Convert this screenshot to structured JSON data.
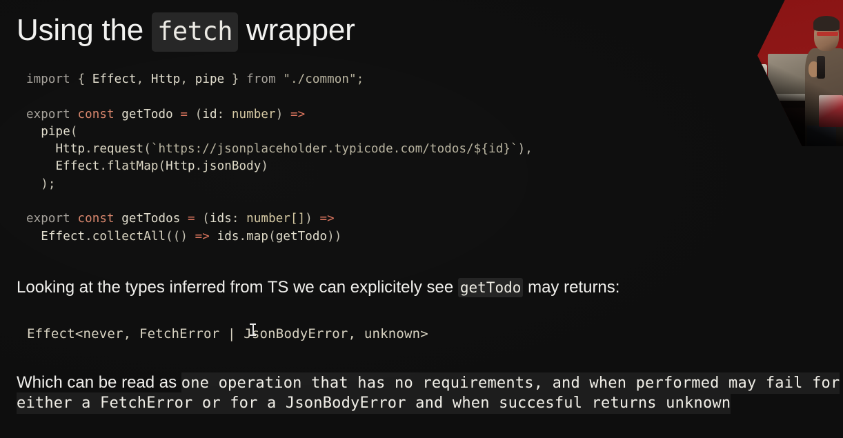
{
  "slide": {
    "background_color": "#0e0e0e",
    "title": {
      "prefix": "Using the ",
      "code": "fetch",
      "suffix": " wrapper"
    },
    "code_block": {
      "language": "typescript",
      "lines": [
        {
          "tokens": [
            {
              "text": "import",
              "kind": "keyword"
            },
            {
              "text": " { ",
              "kind": "punct"
            },
            {
              "text": "Effect",
              "kind": "identifier"
            },
            {
              "text": ", ",
              "kind": "punct"
            },
            {
              "text": "Http",
              "kind": "identifier"
            },
            {
              "text": ", ",
              "kind": "punct"
            },
            {
              "text": "pipe",
              "kind": "identifier"
            },
            {
              "text": " } ",
              "kind": "punct"
            },
            {
              "text": "from",
              "kind": "keyword"
            },
            {
              "text": " \"./common\";",
              "kind": "string"
            }
          ]
        },
        {
          "tokens": []
        },
        {
          "tokens": [
            {
              "text": "export",
              "kind": "keyword"
            },
            {
              "text": " ",
              "kind": "punct"
            },
            {
              "text": "const",
              "kind": "declaration"
            },
            {
              "text": " ",
              "kind": "punct"
            },
            {
              "text": "getTodo",
              "kind": "identifier"
            },
            {
              "text": " ",
              "kind": "punct"
            },
            {
              "text": "=",
              "kind": "operator"
            },
            {
              "text": " (",
              "kind": "punct"
            },
            {
              "text": "id",
              "kind": "identifier"
            },
            {
              "text": ": ",
              "kind": "punct"
            },
            {
              "text": "number",
              "kind": "type"
            },
            {
              "text": ") ",
              "kind": "punct"
            },
            {
              "text": "=>",
              "kind": "operator"
            }
          ]
        },
        {
          "tokens": [
            {
              "text": "  ",
              "kind": "punct"
            },
            {
              "text": "pipe",
              "kind": "identifier"
            },
            {
              "text": "(",
              "kind": "punct"
            }
          ]
        },
        {
          "tokens": [
            {
              "text": "    ",
              "kind": "punct"
            },
            {
              "text": "Http",
              "kind": "identifier"
            },
            {
              "text": ".",
              "kind": "punct"
            },
            {
              "text": "request",
              "kind": "property"
            },
            {
              "text": "(",
              "kind": "punct"
            },
            {
              "text": "`https://jsonplaceholder.typicode.com/todos/${id}`",
              "kind": "string"
            },
            {
              "text": "),",
              "kind": "punct"
            }
          ]
        },
        {
          "tokens": [
            {
              "text": "    ",
              "kind": "punct"
            },
            {
              "text": "Effect",
              "kind": "identifier"
            },
            {
              "text": ".",
              "kind": "punct"
            },
            {
              "text": "flatMap",
              "kind": "property"
            },
            {
              "text": "(",
              "kind": "punct"
            },
            {
              "text": "Http",
              "kind": "identifier"
            },
            {
              "text": ".",
              "kind": "punct"
            },
            {
              "text": "jsonBody",
              "kind": "property"
            },
            {
              "text": ")",
              "kind": "punct"
            }
          ]
        },
        {
          "tokens": [
            {
              "text": "  );",
              "kind": "punct"
            }
          ]
        },
        {
          "tokens": []
        },
        {
          "tokens": [
            {
              "text": "export",
              "kind": "keyword"
            },
            {
              "text": " ",
              "kind": "punct"
            },
            {
              "text": "const",
              "kind": "declaration"
            },
            {
              "text": " ",
              "kind": "punct"
            },
            {
              "text": "getTodos",
              "kind": "identifier"
            },
            {
              "text": " ",
              "kind": "punct"
            },
            {
              "text": "=",
              "kind": "operator"
            },
            {
              "text": " (",
              "kind": "punct"
            },
            {
              "text": "ids",
              "kind": "identifier"
            },
            {
              "text": ": ",
              "kind": "punct"
            },
            {
              "text": "number[]",
              "kind": "type"
            },
            {
              "text": ") ",
              "kind": "punct"
            },
            {
              "text": "=>",
              "kind": "operator"
            }
          ]
        },
        {
          "tokens": [
            {
              "text": "  ",
              "kind": "punct"
            },
            {
              "text": "Effect",
              "kind": "identifier"
            },
            {
              "text": ".",
              "kind": "punct"
            },
            {
              "text": "collectAll",
              "kind": "property"
            },
            {
              "text": "(() ",
              "kind": "punct"
            },
            {
              "text": "=>",
              "kind": "operator"
            },
            {
              "text": " ",
              "kind": "punct"
            },
            {
              "text": "ids",
              "kind": "identifier"
            },
            {
              "text": ".",
              "kind": "punct"
            },
            {
              "text": "map",
              "kind": "property"
            },
            {
              "text": "(",
              "kind": "punct"
            },
            {
              "text": "getTodo",
              "kind": "identifier"
            },
            {
              "text": "))",
              "kind": "punct"
            }
          ]
        }
      ]
    },
    "paragraph_types": {
      "before": "Looking at the types inferred from TS we can explicitely see ",
      "code": "getTodo",
      "after": " may returns:"
    },
    "inferred_type": "Effect<never, FetchError | JsonBodyError, unknown>",
    "paragraph_readas": {
      "line1_plain": "Which can be read as ",
      "line1_mono": "one operation that has no requirements, and when performed may fail for",
      "line2_mono": "either a FetchError or for a JsonBodyError and when succesful returns unknown"
    },
    "webcam": {
      "label": "presenter-webcam",
      "description": "Speaker at a table with a laptop in front of a red backdrop, holding a microphone",
      "backdrop_color": "#8a1414"
    },
    "colors": {
      "background": "#0e0e0e",
      "text": "#f0efec",
      "code_text": "#d8d4c4",
      "keyword": "#a6a29b",
      "declaration": "#d9866c",
      "operator": "#d9735c",
      "type": "#d6c9a3",
      "string": "#b9b4a0",
      "chip_background": "#262626",
      "mono_run_background": "#1d1d1d"
    }
  }
}
